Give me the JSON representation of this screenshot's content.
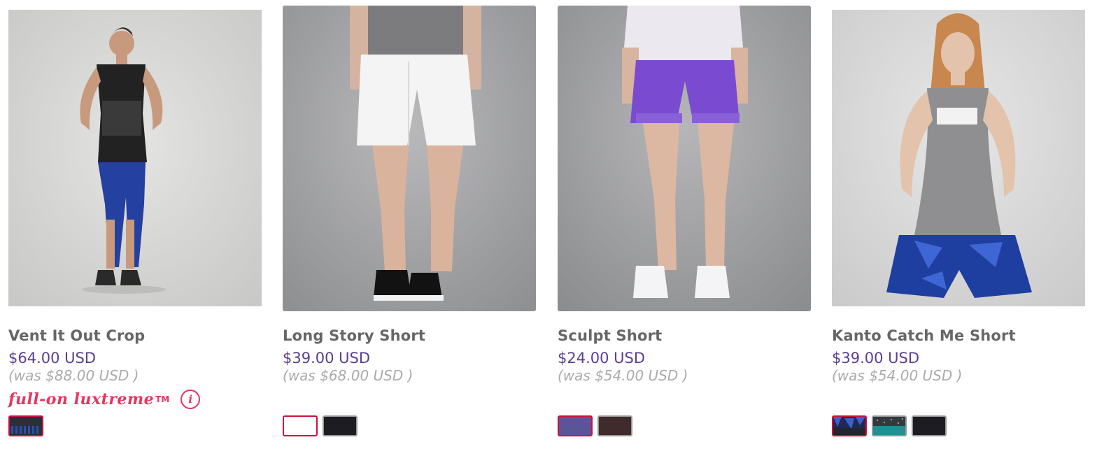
{
  "products": [
    {
      "name": "Vent It Out Crop",
      "price": "$64.00 USD",
      "was": "(was $88.00 USD )",
      "tech": "full-on luxtreme",
      "tech_tm": "TM",
      "info_glyph": "i",
      "swatches": [
        {
          "color": "#26305a",
          "pattern": "stripe",
          "selected": true
        }
      ]
    },
    {
      "name": "Long Story Short",
      "price": "$39.00 USD",
      "was": "(was $68.00 USD )",
      "swatches": [
        {
          "color": "#ffffff",
          "selected": true
        },
        {
          "color": "#1c1c22",
          "selected": false
        }
      ]
    },
    {
      "name": "Sculpt Short",
      "price": "$24.00 USD",
      "was": "(was $54.00 USD )",
      "swatches": [
        {
          "color": "#5a5596",
          "selected": true
        },
        {
          "color": "#3f2b2b",
          "selected": false
        }
      ]
    },
    {
      "name": "Kanto Catch Me Short",
      "price": "$39.00 USD",
      "was": "(was $54.00 USD )",
      "swatches": [
        {
          "color": "#1d3a7c",
          "pattern": "print",
          "selected": true
        },
        {
          "color": "#1e8b8f",
          "pattern": "speckle",
          "selected": false
        },
        {
          "color": "#1c1c22",
          "selected": false
        }
      ]
    }
  ],
  "colors": {
    "price": "#5c3d96",
    "tech": "#e8335d",
    "selected_border": "#d0103a"
  }
}
